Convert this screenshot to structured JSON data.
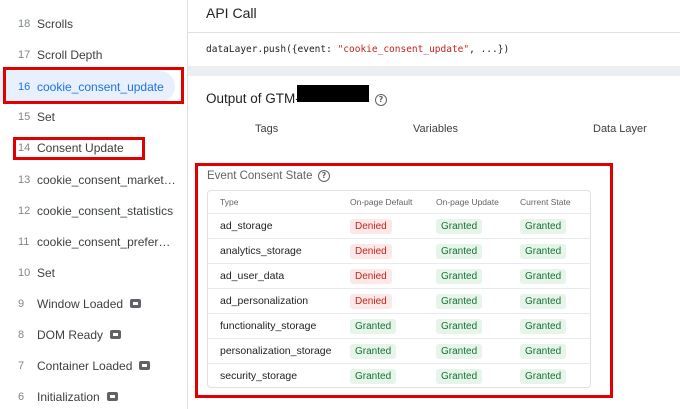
{
  "sidebar": {
    "items": [
      {
        "num": "18",
        "label": "Scrolls",
        "icon": ""
      },
      {
        "num": "17",
        "label": "Scroll Depth",
        "icon": ""
      },
      {
        "num": "16",
        "label": "cookie_consent_update",
        "icon": ""
      },
      {
        "num": "15",
        "label": "Set",
        "icon": ""
      },
      {
        "num": "14",
        "label": "Consent Update",
        "icon": ""
      },
      {
        "num": "13",
        "label": "cookie_consent_marketing",
        "icon": ""
      },
      {
        "num": "12",
        "label": "cookie_consent_statistics",
        "icon": ""
      },
      {
        "num": "11",
        "label": "cookie_consent_preferences",
        "icon": ""
      },
      {
        "num": "10",
        "label": "Set",
        "icon": ""
      },
      {
        "num": "9",
        "label": "Window Loaded",
        "icon": "api-call-icon"
      },
      {
        "num": "8",
        "label": "DOM Ready",
        "icon": "api-call-icon"
      },
      {
        "num": "7",
        "label": "Container Loaded",
        "icon": "api-call-icon"
      },
      {
        "num": "6",
        "label": "Initialization",
        "icon": "api-call-icon"
      }
    ]
  },
  "api_call": {
    "title": "API Call",
    "code_prefix": "dataLayer.push({event: ",
    "code_string": "\"cookie_consent_update\"",
    "code_suffix": ", ...})"
  },
  "output": {
    "title": "Output of GTM-",
    "help_glyph": "?",
    "tabs": [
      "Tags",
      "Variables",
      "Data Layer"
    ]
  },
  "consent_state": {
    "title": "Event Consent State",
    "help_glyph": "?",
    "columns": [
      "Type",
      "On-page Default",
      "On-page Update",
      "Current State"
    ],
    "rows": [
      {
        "type": "ad_storage",
        "default": "Denied",
        "update": "Granted",
        "current": "Granted"
      },
      {
        "type": "analytics_storage",
        "default": "Denied",
        "update": "Granted",
        "current": "Granted"
      },
      {
        "type": "ad_user_data",
        "default": "Denied",
        "update": "Granted",
        "current": "Granted"
      },
      {
        "type": "ad_personalization",
        "default": "Denied",
        "update": "Granted",
        "current": "Granted"
      },
      {
        "type": "functionality_storage",
        "default": "Granted",
        "update": "Granted",
        "current": "Granted"
      },
      {
        "type": "personalization_storage",
        "default": "Granted",
        "update": "Granted",
        "current": "Granted"
      },
      {
        "type": "security_storage",
        "default": "Granted",
        "update": "Granted",
        "current": "Granted"
      }
    ]
  },
  "colors": {
    "accent": "#1a73e8",
    "highlight": "#e00000",
    "denied_bg": "#fce8e6",
    "denied_text": "#c5221f",
    "granted_bg": "#e6f4ea",
    "granted_text": "#137333"
  }
}
